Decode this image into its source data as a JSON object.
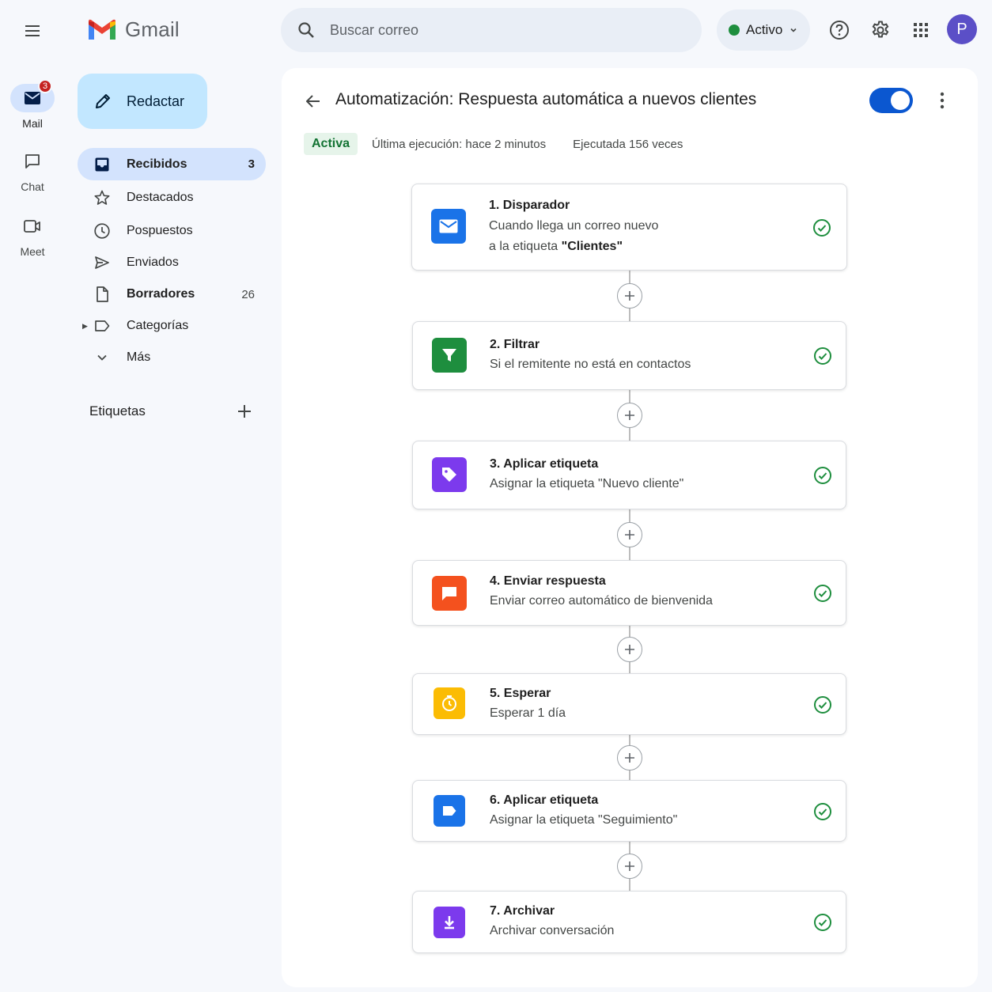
{
  "app": {
    "name": "Gmail"
  },
  "search": {
    "placeholder": "Buscar correo"
  },
  "status": {
    "label": "Activo",
    "color": "#1e8e3e"
  },
  "user": {
    "initial": "P"
  },
  "rail": {
    "mail": {
      "label": "Mail",
      "badge": "3"
    },
    "chat": {
      "label": "Chat"
    },
    "meet": {
      "label": "Meet"
    }
  },
  "compose": {
    "label": "Redactar"
  },
  "nav": {
    "inbox": {
      "label": "Recibidos",
      "count": "3"
    },
    "starred": {
      "label": "Destacados"
    },
    "snoozed": {
      "label": "Pospuestos"
    },
    "sent": {
      "label": "Enviados"
    },
    "drafts": {
      "label": "Borradores",
      "count": "26"
    },
    "categories": {
      "label": "Categorías"
    },
    "more": {
      "label": "Más"
    }
  },
  "labels_section": {
    "title": "Etiquetas"
  },
  "automation": {
    "title": "Automatización: Respuesta automática a nuevos clientes",
    "enabled": true,
    "status_badge": "Activa",
    "last_run": "Última ejecución: hace 2 minutos",
    "run_count": "Ejecutada 156 veces"
  },
  "steps": [
    {
      "title": "1. Disparador",
      "line1": "Cuando llega un correo nuevo",
      "line2_prefix": "a la etiqueta ",
      "line2_bold": "\"Clientes\"",
      "icon": "mail-icon",
      "color": "#1a73e8",
      "done": true
    },
    {
      "title": "2. Filtrar",
      "line1": "Si el remitente no está en contactos",
      "icon": "filter-icon",
      "color": "#1e8e3e",
      "done": true
    },
    {
      "title": "3. Aplicar etiqueta",
      "line1": "Asignar la etiqueta \"Nuevo cliente\"",
      "icon": "tag-icon",
      "color": "#7c3aed",
      "done": true
    },
    {
      "title": "4. Enviar respuesta",
      "line1": "Enviar correo automático de bienvenida",
      "icon": "chat-bubble-icon",
      "color": "#f4511e",
      "done": true
    },
    {
      "title": "5. Esperar",
      "line1": "Esperar 1 día",
      "icon": "timer-icon",
      "color": "#fbbc04",
      "done": true
    },
    {
      "title": "6. Aplicar etiqueta",
      "line1": "Asignar la etiqueta \"Seguimiento\"",
      "icon": "label-icon",
      "color": "#1a73e8",
      "done": true
    },
    {
      "title": "7. Archivar",
      "line1": "Archivar conversación",
      "icon": "archive-icon",
      "color": "#7c3aed",
      "done": true
    }
  ]
}
